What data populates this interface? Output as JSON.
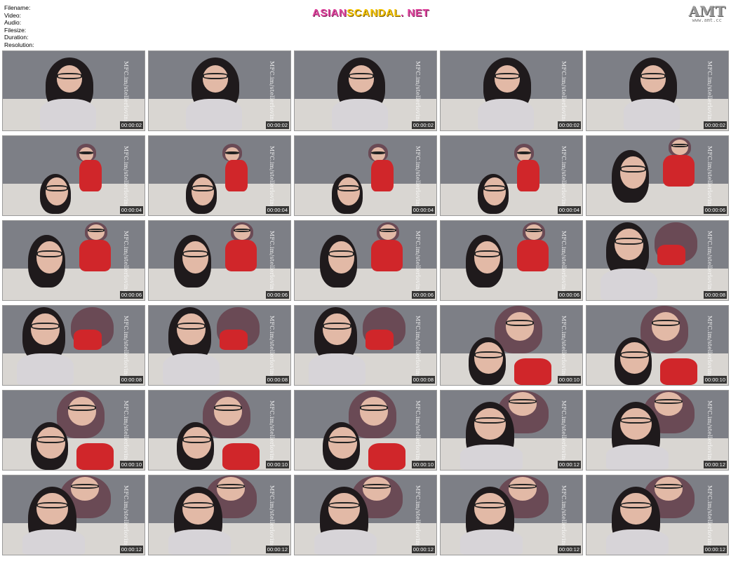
{
  "header": {
    "meta_labels": [
      "Filename:",
      "Video:",
      "Audio:",
      "Filesize:",
      "Duration:",
      "Resolution:"
    ],
    "logo": {
      "part1": "ASIAN",
      "part2": "SCANDAL",
      "part3": ". NET"
    },
    "amt": {
      "big": "AMT",
      "small": "www.amt.cc"
    }
  },
  "thumbnail_watermark": "MFC.im/stellerloving",
  "thumbnails": [
    {
      "time": "00:00:02",
      "scene": "a"
    },
    {
      "time": "00:00:02",
      "scene": "a"
    },
    {
      "time": "00:00:02",
      "scene": "a"
    },
    {
      "time": "00:00:02",
      "scene": "a"
    },
    {
      "time": "00:00:02",
      "scene": "a"
    },
    {
      "time": "00:00:04",
      "scene": "b"
    },
    {
      "time": "00:00:04",
      "scene": "b"
    },
    {
      "time": "00:00:04",
      "scene": "b"
    },
    {
      "time": "00:00:04",
      "scene": "b"
    },
    {
      "time": "00:00:06",
      "scene": "c"
    },
    {
      "time": "00:00:06",
      "scene": "c"
    },
    {
      "time": "00:00:06",
      "scene": "c"
    },
    {
      "time": "00:00:06",
      "scene": "c"
    },
    {
      "time": "00:00:06",
      "scene": "c"
    },
    {
      "time": "00:00:08",
      "scene": "d"
    },
    {
      "time": "00:00:08",
      "scene": "d"
    },
    {
      "time": "00:00:08",
      "scene": "d"
    },
    {
      "time": "00:00:08",
      "scene": "d"
    },
    {
      "time": "00:00:10",
      "scene": "e"
    },
    {
      "time": "00:00:10",
      "scene": "e"
    },
    {
      "time": "00:00:10",
      "scene": "e"
    },
    {
      "time": "00:00:10",
      "scene": "e"
    },
    {
      "time": "00:00:10",
      "scene": "e"
    },
    {
      "time": "00:00:12",
      "scene": "f"
    },
    {
      "time": "00:00:12",
      "scene": "f"
    },
    {
      "time": "00:00:12",
      "scene": "f"
    },
    {
      "time": "00:00:12",
      "scene": "f"
    },
    {
      "time": "00:00:12",
      "scene": "f"
    },
    {
      "time": "00:00:12",
      "scene": "f"
    },
    {
      "time": "00:00:12",
      "scene": "f"
    }
  ],
  "colors": {
    "wall": "#7d7f86",
    "floor": "#d9d6d2",
    "hair": "#1f1a1c",
    "hair2": "#6a4a55",
    "skin": "#e2b9a6",
    "suit_red": "#d0262a",
    "top_white": "#d7d4d8"
  }
}
